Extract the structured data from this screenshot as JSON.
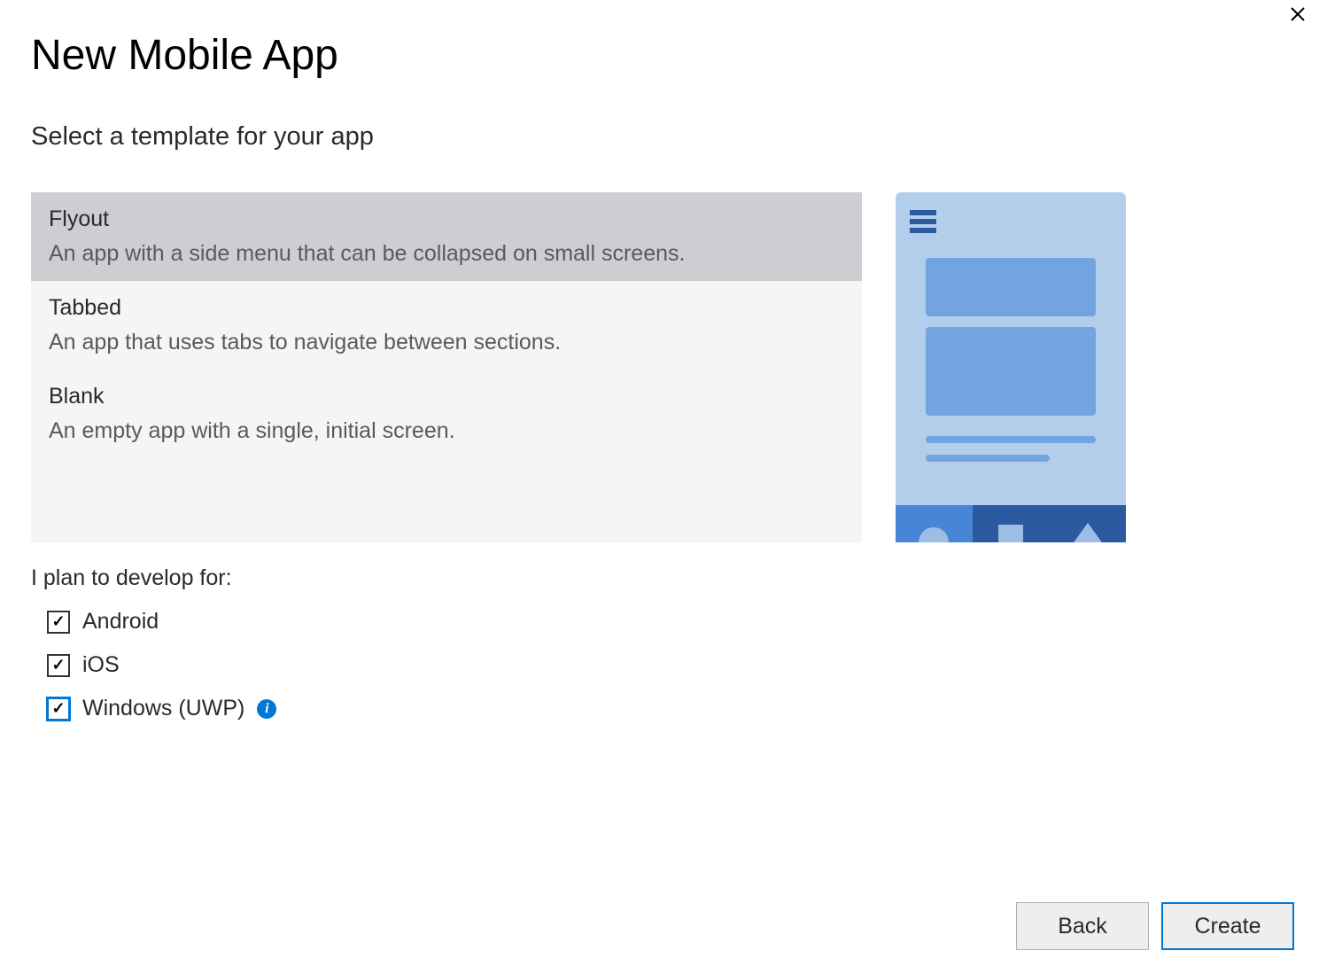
{
  "header": {
    "title": "New Mobile App",
    "subtitle": "Select a template for your app"
  },
  "templates": [
    {
      "name": "Flyout",
      "description": "An app with a side menu that can be collapsed on small screens.",
      "selected": true
    },
    {
      "name": "Tabbed",
      "description": "An app that uses tabs to navigate between sections.",
      "selected": false
    },
    {
      "name": "Blank",
      "description": "An empty app with a single, initial screen.",
      "selected": false
    }
  ],
  "develop": {
    "label": "I plan to develop for:",
    "options": [
      {
        "label": "Android",
        "checked": true,
        "info": false,
        "focused": false
      },
      {
        "label": "iOS",
        "checked": true,
        "info": false,
        "focused": false
      },
      {
        "label": "Windows (UWP)",
        "checked": true,
        "info": true,
        "focused": true
      }
    ]
  },
  "buttons": {
    "back": "Back",
    "create": "Create"
  },
  "checkmark": "✓",
  "info_glyph": "i"
}
